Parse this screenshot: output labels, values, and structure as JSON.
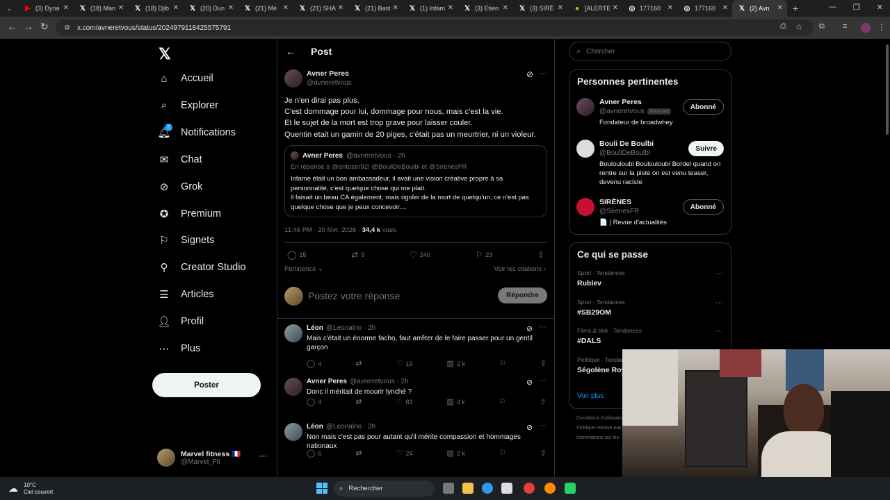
{
  "browser": {
    "tabs": [
      {
        "icon": "youtube-icon",
        "label": "(3) Dyna",
        "color": "#ff0000"
      },
      {
        "icon": "x-logo-icon",
        "label": "(18) Man"
      },
      {
        "icon": "x-logo-icon",
        "label": "(18) Djib"
      },
      {
        "icon": "x-logo-icon",
        "label": "(20) Dun"
      },
      {
        "icon": "x-logo-icon",
        "label": "(21) Mé"
      },
      {
        "icon": "x-logo-icon",
        "label": "(21) SHA"
      },
      {
        "icon": "x-logo-icon",
        "label": "(21) Bast"
      },
      {
        "icon": "x-logo-icon",
        "label": "(1) Infam"
      },
      {
        "icon": "x-logo-icon",
        "label": "(3) Etien"
      },
      {
        "icon": "x-logo-icon",
        "label": "(3) SIRÈ"
      },
      {
        "icon": "alert-icon",
        "label": "[ALERTE"
      },
      {
        "icon": "globe-icon",
        "label": "177160"
      },
      {
        "icon": "globe-icon",
        "label": "177160"
      },
      {
        "icon": "x-logo-icon",
        "label": "(2) Avn",
        "active": true
      }
    ],
    "url": "x.com/avneretvous/status/2024979118425575791"
  },
  "nav": {
    "items": [
      {
        "icon": "home-icon",
        "label": "Accueil"
      },
      {
        "icon": "search-icon",
        "label": "Explorer"
      },
      {
        "icon": "bell-icon",
        "label": "Notifications",
        "badge": "2"
      },
      {
        "icon": "mail-icon",
        "label": "Chat"
      },
      {
        "icon": "grok-icon",
        "label": "Grok"
      },
      {
        "icon": "verified-icon",
        "label": "Premium"
      },
      {
        "icon": "bookmark-icon",
        "label": "Signets"
      },
      {
        "icon": "creator-icon",
        "label": "Creator Studio"
      },
      {
        "icon": "article-icon",
        "label": "Articles"
      },
      {
        "icon": "person-icon",
        "label": "Profil"
      },
      {
        "icon": "more-circle-icon",
        "label": "Plus"
      }
    ],
    "post_button": "Poster",
    "me": {
      "name": "Marvel fitness 🇫🇷",
      "handle": "@Marvel_Flt"
    }
  },
  "post": {
    "header": "Post",
    "author": "Avner Peres",
    "handle": "@avneretvous",
    "lines": [
      "Je n'en dirai pas plus.",
      "C'est dommage pour lui, dommage pour nous, mais c'est la vie.",
      "Et le sujet de la mort est trop grave pour laisser couler.",
      "Quentin etait un gamin de 20 piges, c'était pas un meurtrier, ni un violeur."
    ],
    "quote": {
      "author": "Avner Peres",
      "meta": "@avneretvous · 2h",
      "reply_to": "En réponse à @antozer92! @BouliDeBoulbi  et  @SirenesFR",
      "text": "Infame était un bon ambassadeur, il avait une vision créative propre à sa personnalité, c'est quelque chose qui me plait.\nil faisait un beau CA également, mais rigoler de la mort de quelqu'un, ce n'est pas quelque chose que je peux concevoir...."
    },
    "time": "11:46 PM · 20 févr. 2026 · ",
    "views": "34,4 k",
    "views_label": " vues",
    "stats": {
      "replies": "15",
      "reposts": "9",
      "likes": "240",
      "bookmarks": "23"
    },
    "sort": "Pertinence",
    "quotes_link": "Voir les citations",
    "reply_placeholder": "Postez votre réponse",
    "reply_button": "Répondre"
  },
  "replies": [
    {
      "name": "Léon",
      "meta": "@Leonalno · 2h",
      "text": "Mais c'était un énorme facho, faut arrêter de le faire passer pour un gentil garçon",
      "replies": "4",
      "reposts": "",
      "likes": "19",
      "views": "2 k"
    },
    {
      "name": "Avner Peres",
      "meta": "@avneretvous · 2h",
      "text": "Donc il méritait de mourir lynché ?",
      "replies": "4",
      "reposts": "",
      "likes": "83",
      "views": "4 k"
    },
    {
      "name": "Léon",
      "meta": "@Leonalno · 2h",
      "text": "Non mais c'est pas pour autant qu'il mérite compassion et hommages nationaux",
      "replies": "6",
      "reposts": "",
      "likes": "24",
      "views": "2 k"
    }
  ],
  "right": {
    "search_placeholder": "Chercher",
    "relevant_title": "Personnes pertinentes",
    "people": [
      {
        "name": "Avner Peres",
        "handle": "@avneretvous",
        "tag": "Vous suit",
        "bio": "Fondateur de broadwhey",
        "button": "Abonné"
      },
      {
        "name": "Bouli De Boulbi",
        "handle": "@BouliDeBoulbi",
        "tag": "",
        "bio": "Boulouloubl Boulouloubl Bordel quand on rentre sur la piste on est venu teaser, devenu raciste",
        "button": "Suivre"
      },
      {
        "name": "SIRÈNES",
        "handle": "@SirenesFR",
        "tag": "",
        "bio": "📄 | Revue d'actualités",
        "button": "Abonné"
      }
    ],
    "trends_title": "Ce qui se passe",
    "trends": [
      {
        "cat": "Sport · Tendances",
        "name": "Rublev"
      },
      {
        "cat": "Sport · Tendances",
        "name": "#SB29OM"
      },
      {
        "cat": "Films & télé · Tendances",
        "name": "#DALS"
      },
      {
        "cat": "Politique · Tendances",
        "name": "Ségolène Royal"
      }
    ],
    "more": "Voir plus",
    "footer": [
      "Conditions d'utilisation",
      "Politique relative aux",
      "Informations sur les"
    ]
  },
  "taskbar": {
    "weather_temp": "10°C",
    "weather_desc": "Ciel couvert",
    "search": "Rechercher"
  }
}
